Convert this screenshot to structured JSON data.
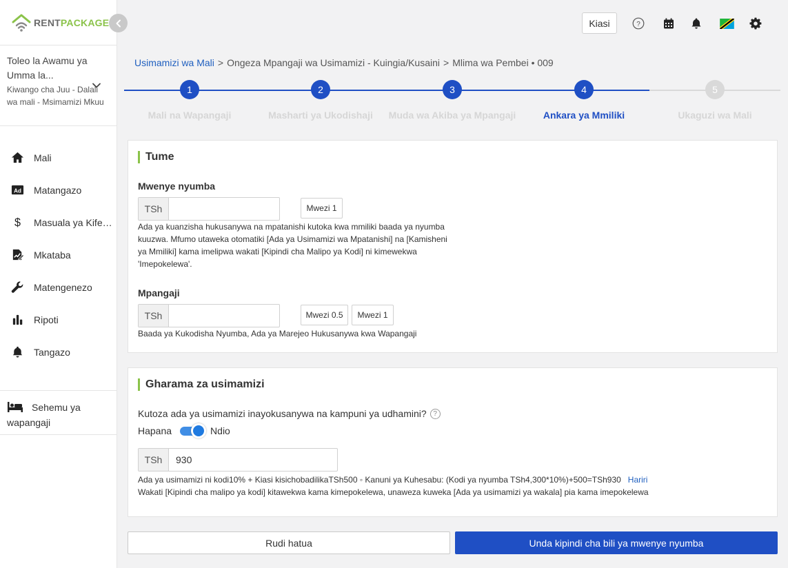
{
  "brand": {
    "rent": "RENT",
    "package": "PACKAGE",
    "accent": "#8bc34a"
  },
  "account": {
    "name": "Toleo la Awamu ya Umma la...",
    "role": "Kiwango cha Juu - Dalali wa mali - Msimamizi Mkuu"
  },
  "sidebar": {
    "items": [
      {
        "label": "Mali",
        "icon": "home-icon"
      },
      {
        "label": "Matangazo",
        "icon": "ad-icon"
      },
      {
        "label": "Masuala ya Kifedha",
        "icon": "dollar-icon"
      },
      {
        "label": "Mkataba",
        "icon": "contract-icon"
      },
      {
        "label": "Matengenezo",
        "icon": "wrench-icon"
      },
      {
        "label": "Ripoti",
        "icon": "bar-chart-icon"
      },
      {
        "label": "Tangazo",
        "icon": "bell-icon"
      }
    ],
    "tenant_section": "Sehemu ya wapangaji"
  },
  "topbar": {
    "kiasi_label": "Kiasi"
  },
  "breadcrumb": {
    "root": "Usimamizi wa Mali",
    "sep": ">",
    "middle": "Ongeza Mpangaji wa Usimamizi - Kuingia/Kusaini",
    "current": "Mlima wa Pembei • 009"
  },
  "stepper": {
    "steps": [
      {
        "num": "1",
        "label": "Mali na Wapangaji",
        "state": "done"
      },
      {
        "num": "2",
        "label": "Masharti ya Ukodishaji",
        "state": "done"
      },
      {
        "num": "3",
        "label": "Muda wa Akiba ya Mpangaji",
        "state": "done"
      },
      {
        "num": "4",
        "label": "Ankara ya Mmiliki",
        "state": "current"
      },
      {
        "num": "5",
        "label": "Ukaguzi wa Mali",
        "state": "todo"
      }
    ],
    "active_color": "#1f4fc4",
    "inactive_color": "#d9d9d9"
  },
  "commission": {
    "title": "Tume",
    "landlord": {
      "label": "Mwenye nyumba",
      "currency": "TSh",
      "value": "",
      "chip": "Mwezi 1",
      "help": "Ada ya kuanzisha hukusanywa na mpatanishi kutoka kwa mmiliki baada ya nyumba kuuzwa. Mfumo utaweka otomatiki [Ada ya Usimamizi wa Mpatanishi] na [Kamisheni ya Mmiliki] kama imelipwa wakati [Kipindi cha Malipo ya Kodi] ni kimewekwa 'Imepokelewa'."
    },
    "tenant": {
      "label": "Mpangaji",
      "currency": "TSh",
      "value": "",
      "chip1": "Mwezi 0.5",
      "chip2": "Mwezi 1",
      "help": "Baada ya Kukodisha Nyumba, Ada ya Marejeo Hukusanywa kwa Wapangaji"
    }
  },
  "management": {
    "title": "Gharama za usimamizi",
    "question": "Kutoza ada ya usimamizi inayokusanywa na kampuni ya udhamini?",
    "question_icon": "?",
    "toggle_off": "Hapana",
    "toggle_on": "Ndio",
    "toggle_state": "on",
    "currency": "TSh",
    "value": "930",
    "formula": "Ada ya usimamizi ni kodi10% + Kiasi kisichobadilikaTSh500 ◦ Kanuni ya Kuhesabu: (Kodi ya nyumba TSh4,300*10%)+500=TSh930",
    "edit_label": "Hariri",
    "note": "Wakati [Kipindi cha malipo ya kodi] kitawekwa kama kimepokelewa, unaweza kuweka [Ada ya usimamizi ya wakala] pia kama imepokelewa"
  },
  "footer": {
    "back_label": "Rudi hatua",
    "submit_label": "Unda kipindi cha bili ya mwenye nyumba"
  }
}
